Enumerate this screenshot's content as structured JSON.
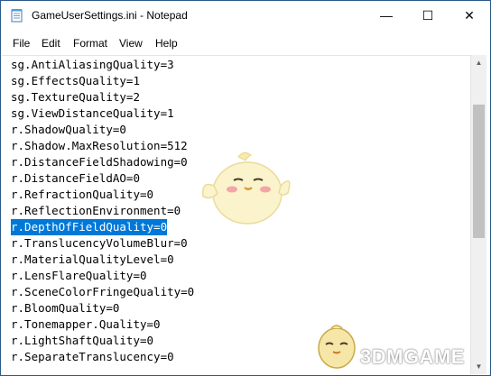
{
  "window": {
    "title": "GameUserSettings.ini - Notepad",
    "minimize_glyph": "—",
    "maximize_glyph": "☐",
    "close_glyph": "✕"
  },
  "menu": {
    "items": [
      {
        "label": "File"
      },
      {
        "label": "Edit"
      },
      {
        "label": "Format"
      },
      {
        "label": "View"
      },
      {
        "label": "Help"
      }
    ]
  },
  "editor": {
    "lines": [
      "sg.AntiAliasingQuality=3",
      "sg.EffectsQuality=1",
      "sg.TextureQuality=2",
      "sg.ViewDistanceQuality=1",
      "r.ShadowQuality=0",
      "r.Shadow.MaxResolution=512",
      "r.DistanceFieldShadowing=0",
      "r.DistanceFieldAO=0",
      "r.RefractionQuality=0",
      "r.ReflectionEnvironment=0",
      "r.DepthOfFieldQuality=0",
      "r.TranslucencyVolumeBlur=0",
      "r.MaterialQualityLevel=0",
      "r.LensFlareQuality=0",
      "r.SceneColorFringeQuality=0",
      "r.BloomQuality=0",
      "r.Tonemapper.Quality=0",
      "r.LightShaftQuality=0",
      "r.SeparateTranslucency=0"
    ],
    "selected_line": 10,
    "selection_color": "#0078d7"
  },
  "scrollbar": {
    "up_arrow": "▲",
    "down_arrow": "▼"
  },
  "watermark": {
    "text": "3DMGAME"
  },
  "icons": {
    "app": "notepad-icon",
    "mascot": "mascot-chick-icon"
  }
}
